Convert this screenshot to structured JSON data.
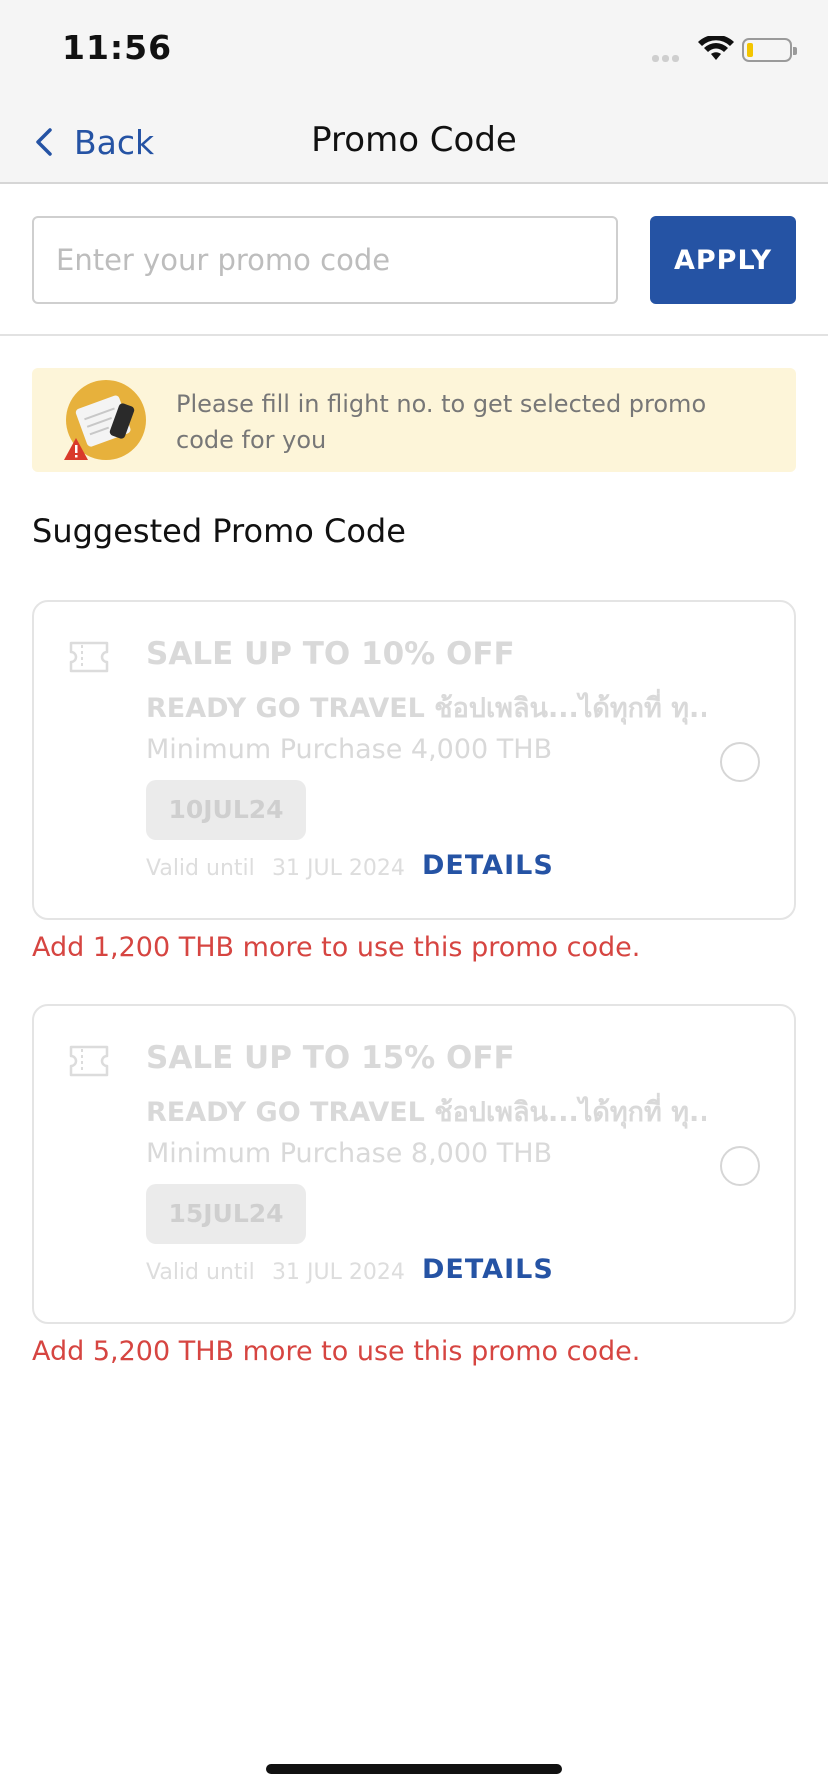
{
  "status_bar": {
    "time": "11:56",
    "battery_level": 0.15,
    "battery_color": "#f3c500"
  },
  "nav": {
    "back_label": "Back",
    "back_icon": "chevron-left-icon",
    "title": "Promo Code"
  },
  "promo_input": {
    "value": "",
    "placeholder": "Enter your promo code",
    "apply_label": "APPLY"
  },
  "notice": {
    "icon": "flight-ticket-warning-icon",
    "text": "Please fill in flight no. to get selected promo code for you"
  },
  "suggested": {
    "title": "Suggested Promo Code",
    "cards": [
      {
        "icon": "ticket-icon",
        "title": "SALE UP TO 10% OFF",
        "description": "READY GO TRAVEL ช้อปเพลิน...ได้ทุกที่ ทุ...",
        "minimum": "Minimum Purchase 4,000 THB",
        "code": "10JUL24",
        "valid_label": "Valid until",
        "valid_date": "31 JUL 2024",
        "details_label": "DETAILS",
        "selected": false,
        "warning": "Add 1,200 THB more to use this promo code."
      },
      {
        "icon": "ticket-icon",
        "title": "SALE UP TO 15% OFF",
        "description": "READY GO TRAVEL ช้อปเพลิน...ได้ทุกที่ ทุ...",
        "minimum": "Minimum Purchase 8,000 THB",
        "code": "15JUL24",
        "valid_label": "Valid until",
        "valid_date": "31 JUL 2024",
        "details_label": "DETAILS",
        "selected": false,
        "warning": "Add 5,200 THB more to use this promo code."
      }
    ]
  },
  "colors": {
    "brand_blue": "#2553a4",
    "warning_red": "#d64541",
    "notice_background": "#fdf5d9",
    "disabled_text": "#d9d9d9"
  }
}
